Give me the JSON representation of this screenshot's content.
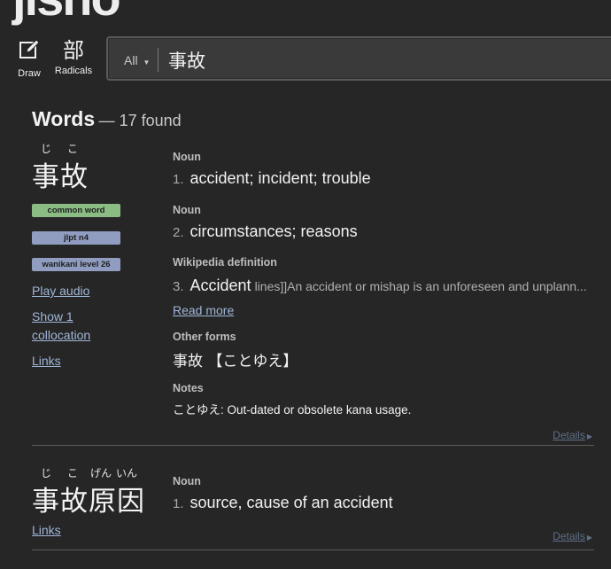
{
  "logo": "jisho",
  "tools": {
    "draw_label": "Draw",
    "radicals_label": "Radicals",
    "radicals_glyph": "部"
  },
  "search": {
    "filter": "All",
    "query": "事故"
  },
  "results_header": {
    "title": "Words",
    "count": "— 17 found"
  },
  "entries": [
    {
      "furigana": [
        "じ",
        "こ"
      ],
      "word": "事故",
      "tags": [
        "common word",
        "jlpt n4",
        "wanikani level 26"
      ],
      "links": [
        "Play audio",
        "Show 1 collocation",
        "Links"
      ],
      "senses": [
        {
          "pos": "Noun",
          "num": "1.",
          "meaning": "accident; incident; trouble"
        },
        {
          "pos": "Noun",
          "num": "2.",
          "meaning": "circumstances; reasons"
        }
      ],
      "wiki": {
        "label": "Wikipedia definition",
        "num": "3.",
        "heading": "Accident",
        "abstract": "lines]]An accident or mishap is an unforeseen and unplann...",
        "more": " Read more"
      },
      "other_forms_label": "Other forms",
      "other_forms": "事故 【ことゆえ】",
      "notes_label": "Notes",
      "notes": "ことゆえ: Out-dated or obsolete kana usage.",
      "details": "Details"
    },
    {
      "furigana": [
        "じ",
        "こ",
        "げん",
        "いん"
      ],
      "word": "事故原因",
      "links": [
        "Links"
      ],
      "senses": [
        {
          "pos": "Noun",
          "num": "1.",
          "meaning": "source, cause of an accident"
        }
      ],
      "details": "Details"
    }
  ],
  "icons": {
    "draw": "pencil-square-icon",
    "details_arrow": "triangle-right-icon",
    "dropdown": "caret-down-icon"
  }
}
